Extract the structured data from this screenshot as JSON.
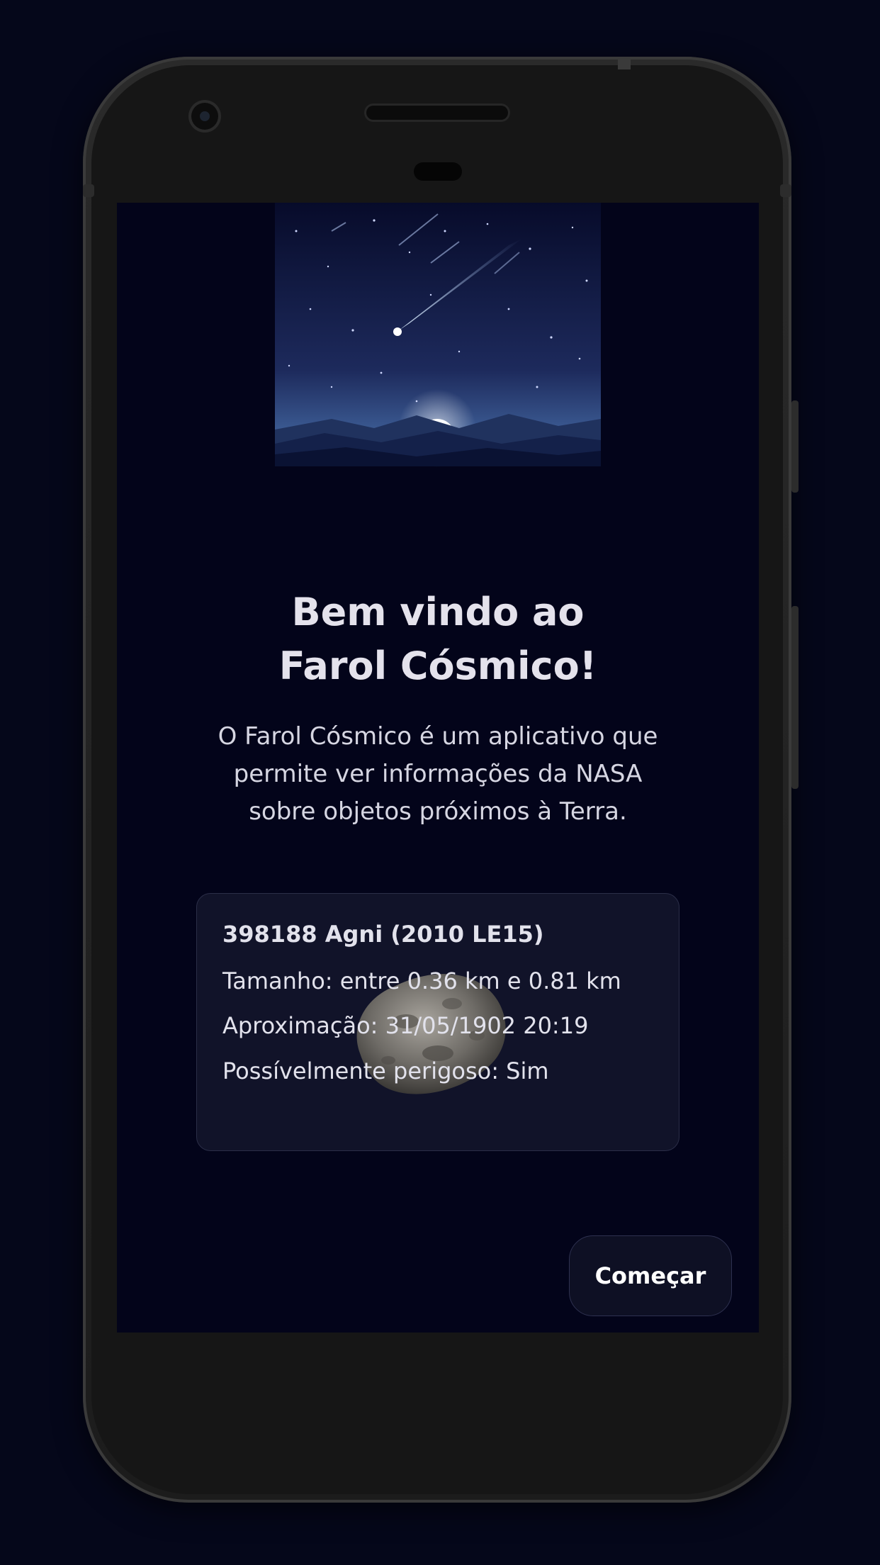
{
  "colors": {
    "page_background": "#05071a",
    "screen_background": "#03041a",
    "card_border": "#2b2e48",
    "text_primary": "#e4e2ec"
  },
  "welcome": {
    "title_line1": "Bem vindo ao",
    "title_line2": "Farol Cósmico!",
    "description": "O Farol Cósmico é um aplicativo que permite ver informações da NASA sobre objetos próximos à Terra."
  },
  "asteroid_card": {
    "name": "398188 Agni (2010 LE15)",
    "size": "Tamanho: entre 0.36 km e 0.81 km",
    "approach": "Aproximação: 31/05/1902 20:19",
    "hazardous": "Possívelmente perigoso: Sim",
    "image_icon": "asteroid-image"
  },
  "actions": {
    "start_label": "Começar"
  },
  "hero": {
    "image_icon": "night-sky-comet-illustration"
  }
}
